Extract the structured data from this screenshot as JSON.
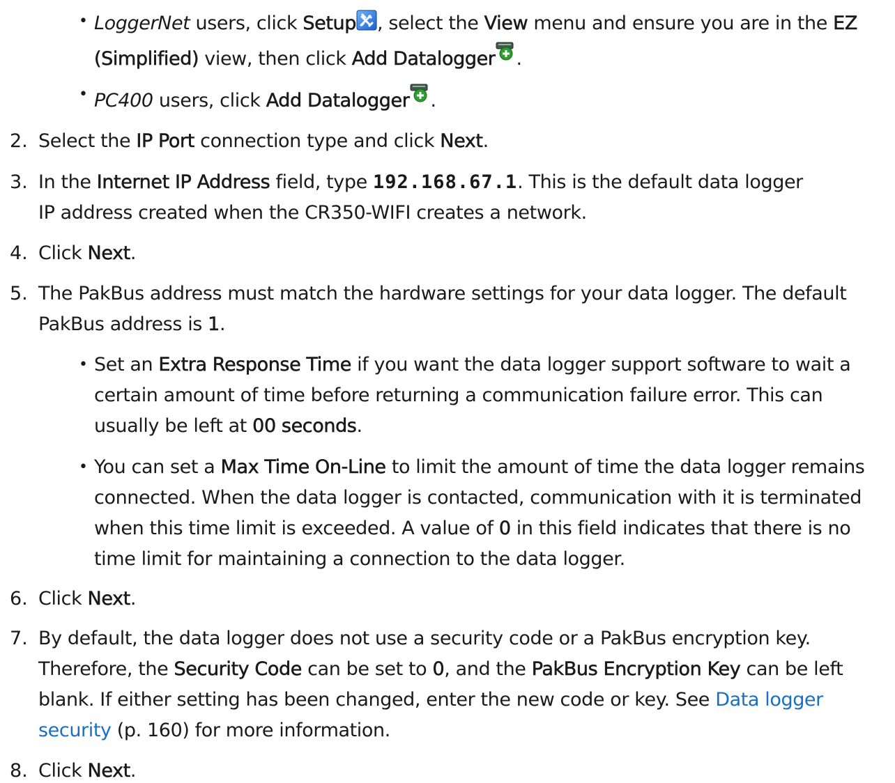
{
  "sub_bullets_top": [
    {
      "l1": {
        "a": "LoggerNet",
        "b": " users, click ",
        "c": "Setup",
        "d": ", select the ",
        "e": "View",
        "f": " menu and ensure you are in the ",
        "g": "EZ"
      },
      "l2": {
        "a": "(Simplified)",
        "b": " view, then click ",
        "c": "Add Datalogger",
        "d": "."
      }
    },
    {
      "l1": {
        "a": "PC400",
        "b": " users, click ",
        "c": "Add Datalogger",
        "d": "."
      }
    }
  ],
  "steps": {
    "s2": {
      "num": "2.",
      "a": "Select the ",
      "b": "IP Port",
      "c": " connection type and click ",
      "d": "Next",
      "e": "."
    },
    "s3": {
      "num": "3.",
      "a": "In the ",
      "b": "Internet IP Address",
      "c": " field, type ",
      "d": "192.168.67.1",
      "e": ". This is the default data logger",
      "l2": "IP address created when the CR350-WIFI creates a network."
    },
    "s4": {
      "num": "4.",
      "a": "Click ",
      "b": "Next",
      "c": "."
    },
    "s5": {
      "num": "5.",
      "l1": "The PakBus address must match the hardware settings for your data logger. The default",
      "l2a": "PakBus address is ",
      "l2b": "1",
      "l2c": ".",
      "bullet1": {
        "l1a": "Set an ",
        "l1b": "Extra Response Time",
        "l1c": " if you want the data logger support software to wait a",
        "l2": "certain amount of time before returning a communication failure error. This can",
        "l3a": "usually be left at ",
        "l3b": "00 seconds",
        "l3c": "."
      },
      "bullet2": {
        "l1a": "You can set a ",
        "l1b": "Max Time On-Line",
        "l1c": " to limit the amount of time the data logger remains",
        "l2": "connected. When the data logger is contacted, communication with it is terminated",
        "l3a": "when this time limit is exceeded. A value of ",
        "l3b": "0",
        "l3c": " in this field indicates that there is no",
        "l4": "time limit for maintaining a connection to the data logger."
      }
    },
    "s6": {
      "num": "6.",
      "a": "Click ",
      "b": "Next",
      "c": "."
    },
    "s7": {
      "num": "7.",
      "l1": "By default, the data logger does not use a security code or a PakBus encryption key.",
      "l2a": "Therefore, the ",
      "l2b": "Security Code",
      "l2c": " can be set to ",
      "l2d": "0",
      "l2e": ", and the ",
      "l2f": "PakBus Encryption Key",
      "l2g": " can be left",
      "l3a": "blank. If either setting has been changed, enter the new code or key. See ",
      "l3link": "Data logger",
      "l4link": "security",
      "l4b": " (p. 160) for more information."
    },
    "s8": {
      "num": "8.",
      "a": "Click ",
      "b": "Next",
      "c": "."
    }
  },
  "bullet_char": "•",
  "icons": {
    "setup": "setup-tools-icon",
    "add_datalogger": "add-datalogger-icon"
  },
  "colors": {
    "link": "#1a6fc2",
    "text": "#1a1a1a"
  }
}
